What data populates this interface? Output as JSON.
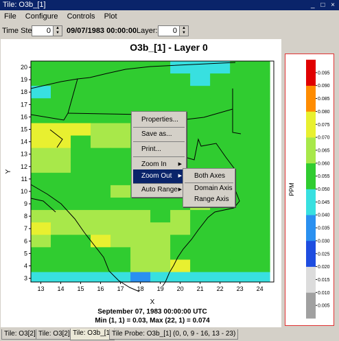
{
  "window": {
    "title": "Tile: O3b_[1]",
    "controls": "_ □ ×"
  },
  "menubar": [
    "File",
    "Configure",
    "Controls",
    "Plot"
  ],
  "toolbar": {
    "time_step_label": "Time Step:",
    "time_step_value": "0",
    "datetime": "09/07/1983 00:00:00",
    "layer_label": "Layer:",
    "layer_value": "0"
  },
  "plot": {
    "title": "O3b_[1] - Layer 0",
    "xlabel": "X",
    "ylabel": "Y",
    "footer_date": "September 07, 1983 00:00:00 UTC",
    "footer_minmax": "Min (1, 1) = 0.03, Max (22, 1) = 0.074"
  },
  "chart_data": {
    "type": "heatmap",
    "x": [
      13,
      14,
      15,
      16,
      17,
      18,
      19,
      20,
      21,
      22,
      23,
      24
    ],
    "y": [
      20,
      19,
      18,
      17,
      16,
      15,
      14,
      13,
      12,
      11,
      10,
      9,
      8,
      7,
      6,
      5,
      4,
      3
    ],
    "xlim": [
      12.5,
      24.7
    ],
    "ylim": [
      2.7,
      20.5
    ],
    "x_ticks": [
      "13",
      "14",
      "15",
      "16",
      "17",
      "18",
      "19",
      "20",
      "21",
      "22",
      "23",
      "24"
    ],
    "y_ticks": [
      "3",
      "4",
      "5",
      "6",
      "7",
      "8",
      "9",
      "10",
      "11",
      "12",
      "13",
      "14",
      "15",
      "16",
      "17",
      "18",
      "19",
      "20"
    ],
    "color_bins": [
      "#a0a0a0",
      "#dcdcdc",
      "#1e4de0",
      "#2a90f0",
      "#38e0e0",
      "#30cc30",
      "#a8e84a",
      "#e8f030",
      "#ff8c00",
      "#e00000"
    ],
    "bin_index_rows": [
      "555555544455",
      "555555554555",
      "455555555555",
      "555555555555",
      "555555555555",
      "777665555555",
      "775665555555",
      "665555555555",
      "665555555555",
      "555555565555",
      "555565555555",
      "555555556555",
      "666666565555",
      "766666665555",
      "655766655555",
      "555556655555",
      "555556675555",
      "444443444444"
    ]
  },
  "legend": {
    "title": "PPM",
    "colors": [
      "#a0a0a0",
      "#dcdcdc",
      "#1e4de0",
      "#2a90f0",
      "#38e0e0",
      "#30cc30",
      "#a8e84a",
      "#e8f030",
      "#ff8c00",
      "#e00000"
    ],
    "ticks": [
      "0.005",
      "0.010",
      "0.015",
      "0.020",
      "0.025",
      "0.030",
      "0.035",
      "0.040",
      "0.045",
      "0.050",
      "0.055",
      "0.060",
      "0.065",
      "0.070",
      "0.075",
      "0.080",
      "0.085",
      "0.090",
      "0.095"
    ]
  },
  "context_menu": {
    "items": [
      "Properties...",
      "Save as...",
      "Print...",
      "Zoom In",
      "Zoom Out",
      "Auto Range"
    ],
    "selected": "Zoom Out"
  },
  "submenu": {
    "items": [
      "Both Axes",
      "Domain Axis",
      "Range Axis"
    ]
  },
  "tabs": [
    {
      "label": "Tile: O3[2]",
      "active": false
    },
    {
      "label": "Tile: O3[2]",
      "active": false
    },
    {
      "label": "Tile: O3b_[1]",
      "active": true
    },
    {
      "label": "Tile Probe: O3b_[1]",
      "active": false
    }
  ],
  "status_text": "(0, 0, 9 - 16, 13 - 23)"
}
